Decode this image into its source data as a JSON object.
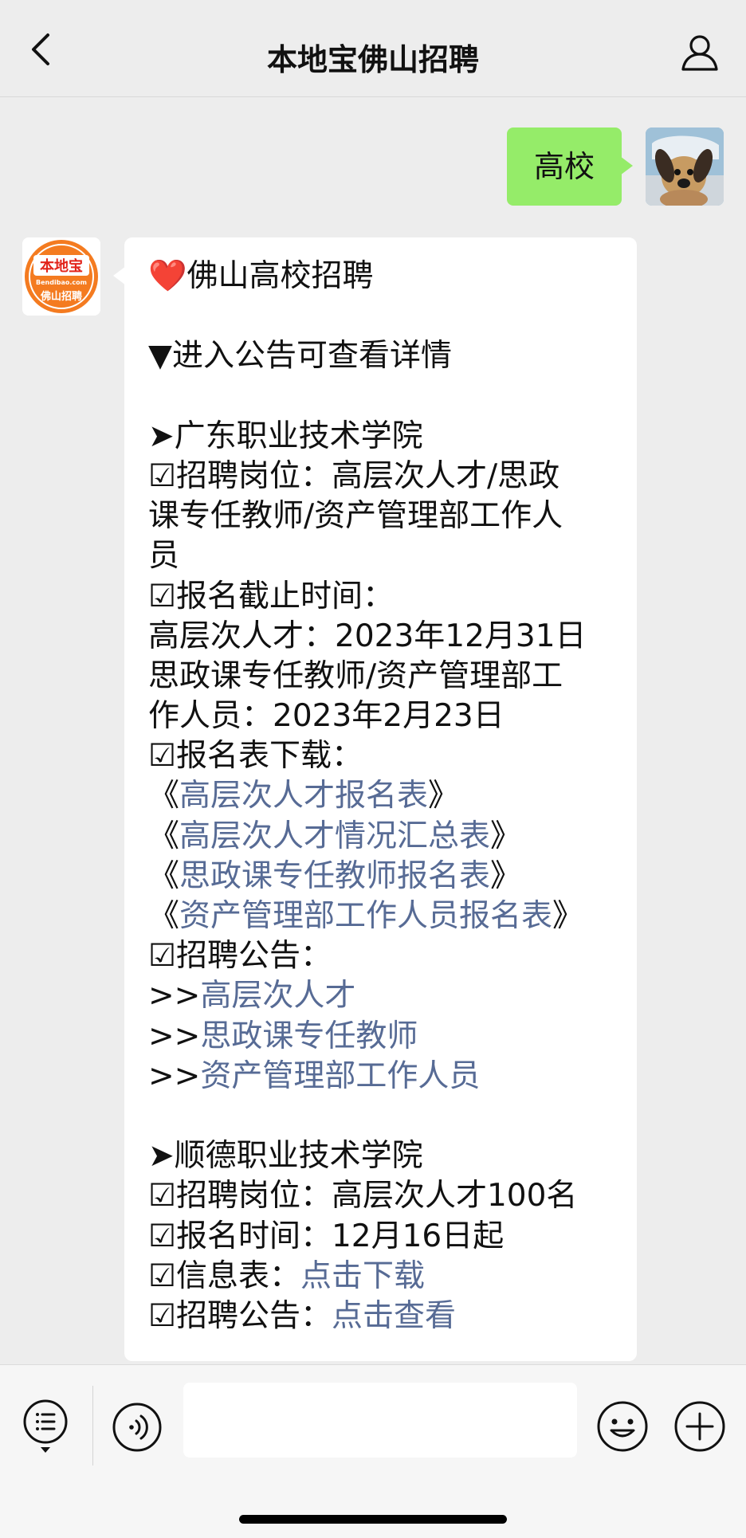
{
  "header": {
    "title": "本地宝佛山招聘"
  },
  "outgoing": {
    "text": "高校"
  },
  "incoming": {
    "avatar": {
      "logo_text": "本地宝",
      "domain_text": "Bendibao.com",
      "sub_text": "佛山招聘"
    },
    "lines": [
      {
        "parts": [
          {
            "text": "❤️佛山高校招聘"
          }
        ]
      },
      {
        "parts": []
      },
      {
        "parts": [
          {
            "text": "▼进入公告可查看详情"
          }
        ]
      },
      {
        "parts": []
      },
      {
        "parts": [
          {
            "text": "➤广东职业技术学院"
          }
        ]
      },
      {
        "parts": [
          {
            "text": "☑招聘岗位：高层次人才/思政"
          }
        ]
      },
      {
        "parts": [
          {
            "text": "课专任教师/资产管理部工作人"
          }
        ]
      },
      {
        "parts": [
          {
            "text": "员"
          }
        ]
      },
      {
        "parts": [
          {
            "text": "☑报名截止时间："
          }
        ]
      },
      {
        "parts": [
          {
            "text": "高层次人才：2023年12月31日"
          }
        ]
      },
      {
        "parts": [
          {
            "text": "思政课专任教师/资产管理部工"
          }
        ]
      },
      {
        "parts": [
          {
            "text": "作人员：2023年2月23日"
          }
        ]
      },
      {
        "parts": [
          {
            "text": "☑报名表下载："
          }
        ]
      },
      {
        "parts": [
          {
            "text": "《"
          },
          {
            "text": "高层次人才报名表",
            "link": true
          },
          {
            "text": "》"
          }
        ]
      },
      {
        "parts": [
          {
            "text": "《"
          },
          {
            "text": "高层次人才情况汇总表",
            "link": true
          },
          {
            "text": "》"
          }
        ]
      },
      {
        "parts": [
          {
            "text": "《"
          },
          {
            "text": "思政课专任教师报名表",
            "link": true
          },
          {
            "text": "》"
          }
        ]
      },
      {
        "parts": [
          {
            "text": "《"
          },
          {
            "text": "资产管理部工作人员报名表",
            "link": true
          },
          {
            "text": "》"
          }
        ]
      },
      {
        "parts": [
          {
            "text": "☑招聘公告："
          }
        ]
      },
      {
        "parts": [
          {
            "text": ">>"
          },
          {
            "text": "高层次人才",
            "link": true
          }
        ]
      },
      {
        "parts": [
          {
            "text": ">>"
          },
          {
            "text": "思政课专任教师",
            "link": true
          }
        ]
      },
      {
        "parts": [
          {
            "text": ">>"
          },
          {
            "text": "资产管理部工作人员",
            "link": true
          }
        ]
      },
      {
        "parts": []
      },
      {
        "parts": [
          {
            "text": "➤顺德职业技术学院"
          }
        ]
      },
      {
        "parts": [
          {
            "text": "☑招聘岗位：高层次人才100名"
          }
        ]
      },
      {
        "parts": [
          {
            "text": "☑报名时间：12月16日起"
          }
        ]
      },
      {
        "parts": [
          {
            "text": "☑信息表："
          },
          {
            "text": "点击下载",
            "link": true
          }
        ]
      },
      {
        "parts": [
          {
            "text": "☑招聘公告："
          },
          {
            "text": "点击查看",
            "link": true
          }
        ]
      }
    ]
  },
  "input": {
    "value": "",
    "placeholder": ""
  },
  "icons": {
    "back": "chevron-left-icon",
    "profile": "person-icon",
    "menu": "menu-list-icon",
    "voice": "voice-icon",
    "emoji": "emoji-icon",
    "plus": "plus-icon"
  },
  "colors": {
    "background": "#ededed",
    "outgoing_bubble": "#95ec69",
    "incoming_bubble": "#ffffff",
    "link": "#576b95",
    "logo_orange": "#f47b20"
  }
}
